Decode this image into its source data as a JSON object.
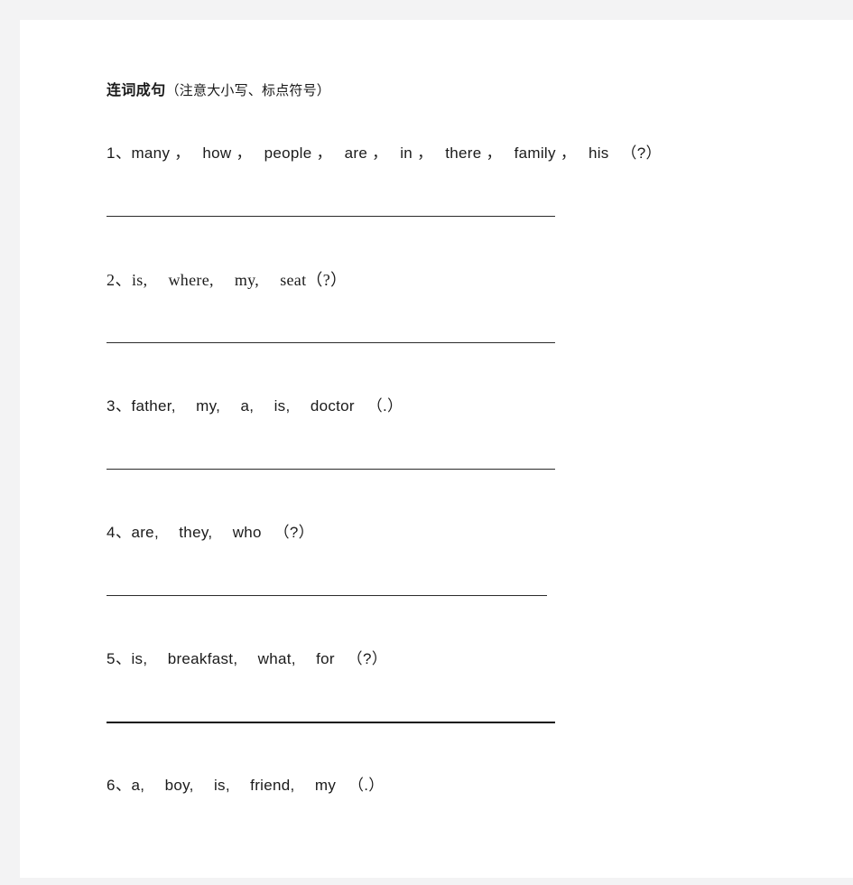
{
  "page": {
    "background_color": "#f3f3f4",
    "paper_color": "#ffffff",
    "text_color": "#1b1b1b",
    "rule_color": "#2b2b2b"
  },
  "title": {
    "main": "连词成句",
    "note": "（注意大小写、标点符号）"
  },
  "questions": [
    {
      "number": "1、",
      "words": "many ，　 how ，　 people ，　 are ，　 in ，　 there ，　 family ，　 his 　（?）",
      "font": "sans",
      "line_width": 497,
      "line_weight": "normal"
    },
    {
      "number": "2、",
      "words": "is,　 where,　 my,　 seat（?）",
      "font": "serif",
      "line_width": 497,
      "line_weight": "normal"
    },
    {
      "number": "3、",
      "words": "father,　 my,　 a,　 is,　 doctor 　（.）",
      "font": "sans",
      "line_width": 497,
      "line_weight": "normal"
    },
    {
      "number": "4、",
      "words": "are,　 they,　 who 　（?）",
      "font": "sans",
      "line_width": 488,
      "line_weight": "normal"
    },
    {
      "number": "5、",
      "words": "is,　 breakfast,　 what,　 for 　（?）",
      "font": "sans",
      "line_width": 497,
      "line_weight": "thick"
    },
    {
      "number": "6、",
      "words": "a,　 boy,　 is,　 friend,　 my 　（.）",
      "font": "sans",
      "line_width": 0,
      "line_weight": "none"
    }
  ]
}
